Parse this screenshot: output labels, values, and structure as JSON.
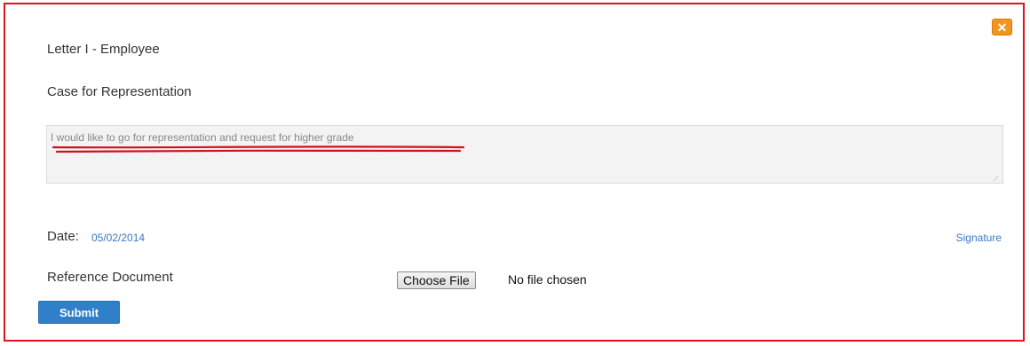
{
  "dialog": {
    "title": "Letter I - Employee",
    "section_title": "Case for Representation",
    "case_text": "I would like to go for representation and request for higher grade",
    "date_label": "Date:",
    "date_value": "05/02/2014",
    "signature_link": "Signature",
    "reference_label": "Reference Document",
    "choose_file_label": "Choose File",
    "no_file_text": "No file chosen",
    "submit_label": "Submit",
    "close_icon": "close-icon",
    "colors": {
      "frame_border": "#e0141e",
      "link": "#3a78c5",
      "submit_bg": "#2f80c8",
      "close_bg": "#f0961e",
      "annotation_underline": "#d0101a"
    }
  }
}
